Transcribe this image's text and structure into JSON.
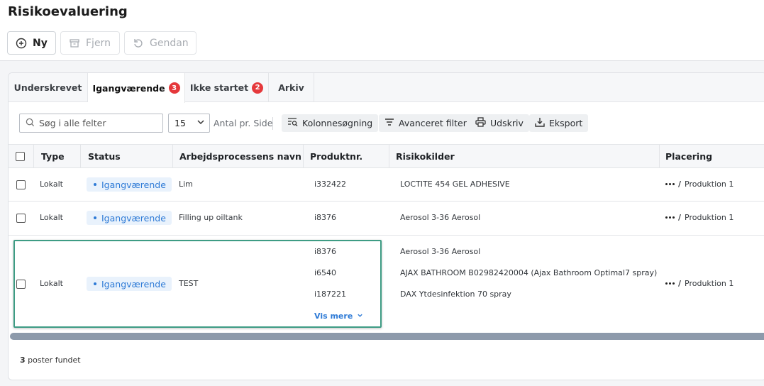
{
  "header": {
    "title": "Risikoevaluering",
    "new_label": "Ny",
    "remove_label": "Fjern",
    "restore_label": "Gendan"
  },
  "tabs": [
    {
      "label": "Underskrevet",
      "badge": ""
    },
    {
      "label": "Igangværende",
      "badge": "3"
    },
    {
      "label": "Ikke startet",
      "badge": "2"
    },
    {
      "label": "Arkiv",
      "badge": ""
    }
  ],
  "toolbar": {
    "search_placeholder": "Søg i alle felter",
    "page_size": "15",
    "page_size_label": "Antal pr. Side",
    "column_search": "Kolonnesøgning",
    "advanced_filter": "Avanceret filter",
    "print": "Udskriv",
    "export": "Eksport"
  },
  "columns": [
    "Type",
    "Status",
    "Arbejdsprocessens navn",
    "Produktnr.",
    "Risikokilder",
    "Placering"
  ],
  "rows": [
    {
      "type": "Lokalt",
      "status": "Igangværende",
      "name": "Lim",
      "products": [
        "i332422"
      ],
      "sources": [
        "LOCTITE 454 GEL ADHESIVE"
      ],
      "placement": "Produktion 1"
    },
    {
      "type": "Lokalt",
      "status": "Igangværende",
      "name": "Filling up oiltank",
      "products": [
        "i8376"
      ],
      "sources": [
        "Aerosol 3-36 Aerosol"
      ],
      "placement": "Produktion 1"
    },
    {
      "type": "Lokalt",
      "status": "Igangværende",
      "name": "TEST",
      "products": [
        "i8376",
        "i6540",
        "i187221"
      ],
      "sources": [
        "Aerosol 3-36 Aerosol",
        "AJAX BATHROOM B02982420004 (Ajax Bathroom Optimal7 spray)",
        "DAX Ytdesinfektion 70 spray"
      ],
      "placement": "Produktion 1",
      "show_more": "Vis mere"
    }
  ],
  "placement_separator": "/",
  "footer": {
    "count": "3",
    "label": "poster fundet"
  },
  "colors": {
    "accent": "#2d7ad6",
    "badge": "#e5383b",
    "highlight": "#3e9c84"
  }
}
